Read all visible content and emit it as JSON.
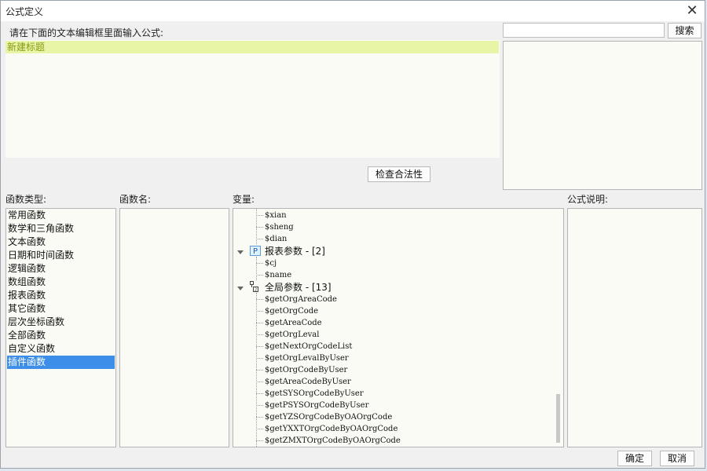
{
  "dialog": {
    "title": "公式定义",
    "instruction": "请在下面的文本编辑框里面输入公式:",
    "editor_text": "新建标题",
    "search_button": "搜索",
    "check_button": "检查合法性",
    "ok_button": "确定",
    "cancel_button": "取消"
  },
  "labels": {
    "function_type": "函数类型:",
    "function_name": "函数名:",
    "variables": "变量:",
    "formula_desc": "公式说明:"
  },
  "function_types": [
    "常用函数",
    "数学和三角函数",
    "文本函数",
    "日期和时间函数",
    "逻辑函数",
    "数组函数",
    "报表函数",
    "其它函数",
    "层次坐标函数",
    "全部函数",
    "自定义函数",
    "插件函数"
  ],
  "selected_function_type": "插件函数",
  "variables": {
    "top_items": [
      "$xian",
      "$sheng",
      "$dian"
    ],
    "report_group": {
      "label": "报表参数 - [2]",
      "items": [
        "$cj",
        "$name"
      ]
    },
    "global_group": {
      "label": "全局参数 - [13]",
      "items": [
        "$getOrgAreaCode",
        "$getOrgCode",
        "$getAreaCode",
        "$getOrgLeval",
        "$getNextOrgCodeList",
        "$getOrgLevalByUser",
        "$getOrgCodeByUser",
        "$getAreaCodeByUser",
        "$getSYSOrgCodeByUser",
        "$getPSYSOrgCodeByUser",
        "$getYZSOrgCodeByOAOrgCode",
        "$getYXXTOrgCodeByOAOrgCode",
        "$getZMXTOrgCodeByOAOrgCode"
      ]
    }
  },
  "icons": {
    "close": "close-icon",
    "report": "p-icon",
    "global": "global-param-icon",
    "expand": "chevron-down-icon"
  },
  "colors": {
    "selection": "#3d8ee8",
    "editor_highlight": "#e8f5a6",
    "editor_text": "#8a9a16"
  }
}
